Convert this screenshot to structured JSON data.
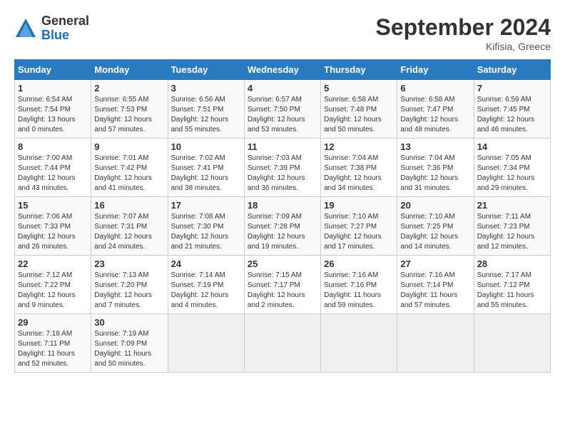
{
  "header": {
    "logo_line1": "General",
    "logo_line2": "Blue",
    "month_title": "September 2024",
    "location": "Kifisia, Greece"
  },
  "weekdays": [
    "Sunday",
    "Monday",
    "Tuesday",
    "Wednesday",
    "Thursday",
    "Friday",
    "Saturday"
  ],
  "weeks": [
    [
      {
        "day": "1",
        "info": "Sunrise: 6:54 AM\nSunset: 7:54 PM\nDaylight: 13 hours\nand 0 minutes."
      },
      {
        "day": "2",
        "info": "Sunrise: 6:55 AM\nSunset: 7:53 PM\nDaylight: 12 hours\nand 57 minutes."
      },
      {
        "day": "3",
        "info": "Sunrise: 6:56 AM\nSunset: 7:51 PM\nDaylight: 12 hours\nand 55 minutes."
      },
      {
        "day": "4",
        "info": "Sunrise: 6:57 AM\nSunset: 7:50 PM\nDaylight: 12 hours\nand 53 minutes."
      },
      {
        "day": "5",
        "info": "Sunrise: 6:58 AM\nSunset: 7:48 PM\nDaylight: 12 hours\nand 50 minutes."
      },
      {
        "day": "6",
        "info": "Sunrise: 6:58 AM\nSunset: 7:47 PM\nDaylight: 12 hours\nand 48 minutes."
      },
      {
        "day": "7",
        "info": "Sunrise: 6:59 AM\nSunset: 7:45 PM\nDaylight: 12 hours\nand 46 minutes."
      }
    ],
    [
      {
        "day": "8",
        "info": "Sunrise: 7:00 AM\nSunset: 7:44 PM\nDaylight: 12 hours\nand 43 minutes."
      },
      {
        "day": "9",
        "info": "Sunrise: 7:01 AM\nSunset: 7:42 PM\nDaylight: 12 hours\nand 41 minutes."
      },
      {
        "day": "10",
        "info": "Sunrise: 7:02 AM\nSunset: 7:41 PM\nDaylight: 12 hours\nand 38 minutes."
      },
      {
        "day": "11",
        "info": "Sunrise: 7:03 AM\nSunset: 7:39 PM\nDaylight: 12 hours\nand 36 minutes."
      },
      {
        "day": "12",
        "info": "Sunrise: 7:04 AM\nSunset: 7:38 PM\nDaylight: 12 hours\nand 34 minutes."
      },
      {
        "day": "13",
        "info": "Sunrise: 7:04 AM\nSunset: 7:36 PM\nDaylight: 12 hours\nand 31 minutes."
      },
      {
        "day": "14",
        "info": "Sunrise: 7:05 AM\nSunset: 7:34 PM\nDaylight: 12 hours\nand 29 minutes."
      }
    ],
    [
      {
        "day": "15",
        "info": "Sunrise: 7:06 AM\nSunset: 7:33 PM\nDaylight: 12 hours\nand 26 minutes."
      },
      {
        "day": "16",
        "info": "Sunrise: 7:07 AM\nSunset: 7:31 PM\nDaylight: 12 hours\nand 24 minutes."
      },
      {
        "day": "17",
        "info": "Sunrise: 7:08 AM\nSunset: 7:30 PM\nDaylight: 12 hours\nand 21 minutes."
      },
      {
        "day": "18",
        "info": "Sunrise: 7:09 AM\nSunset: 7:28 PM\nDaylight: 12 hours\nand 19 minutes."
      },
      {
        "day": "19",
        "info": "Sunrise: 7:10 AM\nSunset: 7:27 PM\nDaylight: 12 hours\nand 17 minutes."
      },
      {
        "day": "20",
        "info": "Sunrise: 7:10 AM\nSunset: 7:25 PM\nDaylight: 12 hours\nand 14 minutes."
      },
      {
        "day": "21",
        "info": "Sunrise: 7:11 AM\nSunset: 7:23 PM\nDaylight: 12 hours\nand 12 minutes."
      }
    ],
    [
      {
        "day": "22",
        "info": "Sunrise: 7:12 AM\nSunset: 7:22 PM\nDaylight: 12 hours\nand 9 minutes."
      },
      {
        "day": "23",
        "info": "Sunrise: 7:13 AM\nSunset: 7:20 PM\nDaylight: 12 hours\nand 7 minutes."
      },
      {
        "day": "24",
        "info": "Sunrise: 7:14 AM\nSunset: 7:19 PM\nDaylight: 12 hours\nand 4 minutes."
      },
      {
        "day": "25",
        "info": "Sunrise: 7:15 AM\nSunset: 7:17 PM\nDaylight: 12 hours\nand 2 minutes."
      },
      {
        "day": "26",
        "info": "Sunrise: 7:16 AM\nSunset: 7:16 PM\nDaylight: 11 hours\nand 59 minutes."
      },
      {
        "day": "27",
        "info": "Sunrise: 7:16 AM\nSunset: 7:14 PM\nDaylight: 11 hours\nand 57 minutes."
      },
      {
        "day": "28",
        "info": "Sunrise: 7:17 AM\nSunset: 7:12 PM\nDaylight: 11 hours\nand 55 minutes."
      }
    ],
    [
      {
        "day": "29",
        "info": "Sunrise: 7:18 AM\nSunset: 7:11 PM\nDaylight: 11 hours\nand 52 minutes."
      },
      {
        "day": "30",
        "info": "Sunrise: 7:19 AM\nSunset: 7:09 PM\nDaylight: 11 hours\nand 50 minutes."
      },
      {
        "day": "",
        "info": ""
      },
      {
        "day": "",
        "info": ""
      },
      {
        "day": "",
        "info": ""
      },
      {
        "day": "",
        "info": ""
      },
      {
        "day": "",
        "info": ""
      }
    ]
  ]
}
